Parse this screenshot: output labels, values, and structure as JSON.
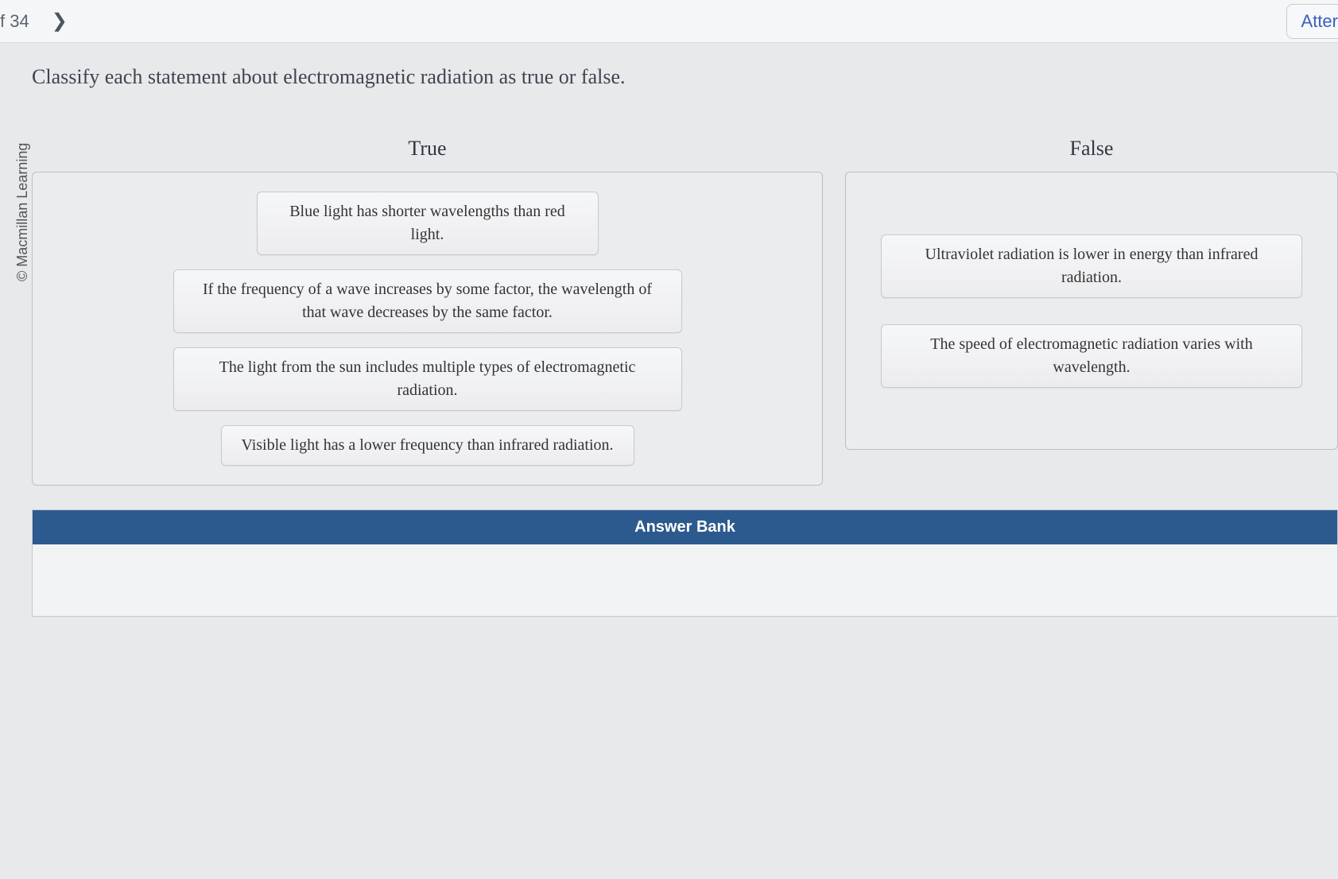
{
  "topbar": {
    "page_of": "f 34",
    "attempt": "Atter"
  },
  "copyright": "© Macmillan Learning",
  "prompt": "Classify each statement about electromagnetic radiation as true or false.",
  "bins": {
    "true_label": "True",
    "false_label": "False"
  },
  "tiles": {
    "t1": "Blue light has shorter wavelengths than red light.",
    "t2": "If the frequency of a wave increases by some factor, the wavelength of that wave decreases by the same factor.",
    "t3": "The light from the sun includes multiple types of electromagnetic radiation.",
    "t4": "Visible light has a lower frequency than infrared radiation.",
    "f1": "Ultraviolet radiation is lower in energy than infrared radiation.",
    "f2": "The speed of electromagnetic radiation varies with wavelength."
  },
  "answer_bank": {
    "header": "Answer Bank"
  }
}
